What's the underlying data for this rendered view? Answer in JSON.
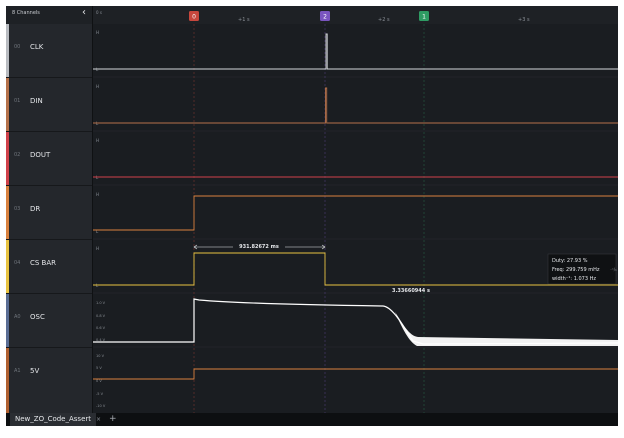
{
  "sidebar": {
    "title": "8 Channels",
    "channels": [
      {
        "num": "00",
        "name": "CLK",
        "color": "#b9bcc1"
      },
      {
        "num": "01",
        "name": "DIN",
        "color": "#b5714a"
      },
      {
        "num": "02",
        "name": "DOUT",
        "color": "#d0414a"
      },
      {
        "num": "03",
        "name": "DR",
        "color": "#d9813e"
      },
      {
        "num": "04",
        "name": "CS BAR",
        "color": "#e8c341"
      },
      {
        "num": "A0",
        "name": "OSC",
        "color": "#5a6d94"
      },
      {
        "num": "A1",
        "name": "5V",
        "color": "#b06030"
      }
    ]
  },
  "timeline": {
    "start_label": "0 s",
    "ticks": [
      "+1 s",
      "+2 s",
      "+3 s"
    ],
    "markers": [
      {
        "label": "0",
        "color": "#c8473d"
      },
      {
        "label": "2",
        "color": "#7a55c0"
      },
      {
        "label": "1",
        "color": "#2e9b63"
      }
    ]
  },
  "level_labels": {
    "high": "H",
    "low": "L"
  },
  "osc_scale": [
    "1.0 V",
    "0.8 V",
    "0.6 V",
    "0.4 V"
  ],
  "v5_scale": [
    "10 V",
    "5 V",
    "0 V",
    "-5 V",
    "-10 V"
  ],
  "measurements": {
    "cs_width": "931.82672 ms",
    "osc_width": "3.33660944 s"
  },
  "tooltip": {
    "duty": "Duty: 27.93 %",
    "freq": "Freq: 299.759 mHz",
    "width": "width⁻¹: 1.073 Hz",
    "side": "⁻¹/ₕ"
  },
  "tabs": [
    {
      "label": "New_ZO_Code_Assert",
      "close": "×"
    }
  ],
  "add_tab": "+",
  "colors": {
    "background": "#1a1d21",
    "panel": "#24272c",
    "trace": "#ffffff"
  }
}
